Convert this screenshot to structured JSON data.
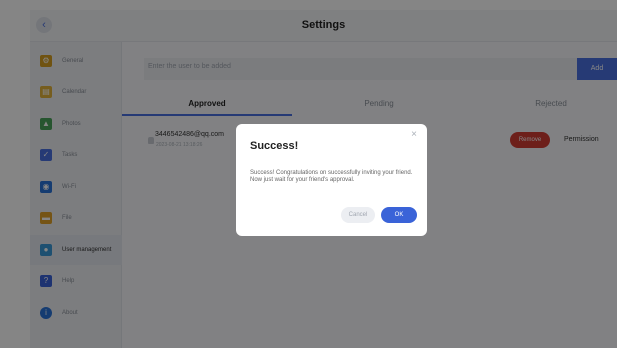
{
  "header": {
    "title": "Settings",
    "back_glyph": "‹"
  },
  "sidebar": {
    "items": [
      {
        "label": "General",
        "icon": "gear-icon",
        "color": "#d6a021"
      },
      {
        "label": "Calendar",
        "icon": "calendar-icon",
        "color": "#e3b33a"
      },
      {
        "label": "Photos",
        "icon": "photos-icon",
        "color": "#4aa35a"
      },
      {
        "label": "Tasks",
        "icon": "tasks-icon",
        "color": "#4a6fe0"
      },
      {
        "label": "Wi-Fi",
        "icon": "wifi-icon",
        "color": "#2a73d8"
      },
      {
        "label": "File",
        "icon": "folder-icon",
        "color": "#e0a22a"
      },
      {
        "label": "User management",
        "icon": "users-icon",
        "color": "#3a9ad8"
      },
      {
        "label": "Help",
        "icon": "help-icon",
        "color": "#3a63d8"
      },
      {
        "label": "About",
        "icon": "info-icon",
        "color": "#2a73d8"
      }
    ],
    "active_index": 6
  },
  "add_user": {
    "placeholder": "Enter the user to be added",
    "button_label": "Add"
  },
  "tabs": [
    {
      "label": "Approved",
      "active": true
    },
    {
      "label": "Pending",
      "active": false
    },
    {
      "label": "Rejected",
      "active": false
    }
  ],
  "users": [
    {
      "email": "3446542486@qq.com",
      "date": "2023-08-21 13:18:26",
      "remove_label": "Remove",
      "permission_label": "Permission"
    }
  ],
  "dialog": {
    "title": "Success!",
    "message": "Success! Congratulations on successfully inviting your friend. Now just wait for your friend's approval.",
    "cancel_label": "Cancel",
    "ok_label": "OK",
    "close_glyph": "×"
  },
  "colors": {
    "accent": "#4a6fe0",
    "danger": "#d13c33",
    "ok_button": "#3a63d8"
  }
}
